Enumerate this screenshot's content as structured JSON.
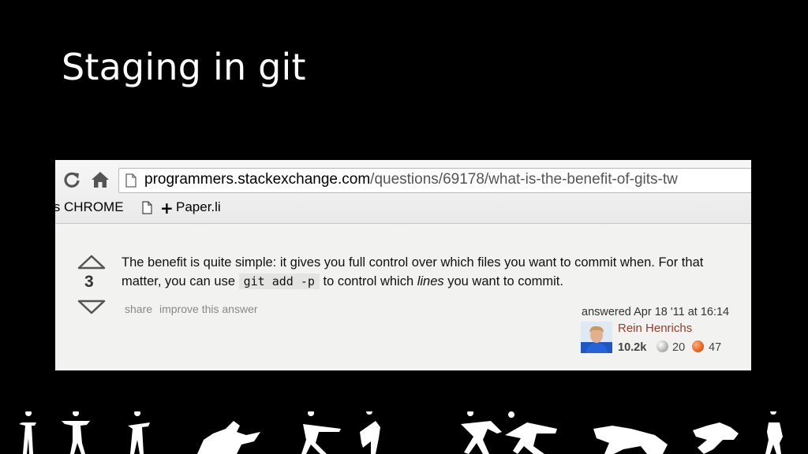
{
  "slide": {
    "title": "Staging in git"
  },
  "browser": {
    "url_domain": "programmers.stackexchange.com",
    "url_path": "/questions/69178/what-is-the-benefit-of-gits-tw",
    "bookmarks": [
      {
        "label": "is CHROME"
      },
      {
        "label": "Paper.li"
      }
    ]
  },
  "answer": {
    "vote_count": "3",
    "text_part1": "The benefit is quite simple: it gives you full control over which files you want to commit when. For that matter, you can use ",
    "code": "git add -p",
    "text_part2": " to control which ",
    "emphasis": "lines",
    "text_part3": " you want to commit.",
    "menu": {
      "share": "share",
      "improve": "improve this answer"
    },
    "answered": "answered Apr 18 '11 at 16:14",
    "user_name": "Rein Henrichs",
    "reputation": "10.2k",
    "silver_badges": "20",
    "bronze_badges": "47"
  },
  "colors": {
    "background": "#000000",
    "title": "#ffffff",
    "user_link": "#9a3b2a",
    "bronze": "#e8641b",
    "silver": "#b5b5b5"
  }
}
